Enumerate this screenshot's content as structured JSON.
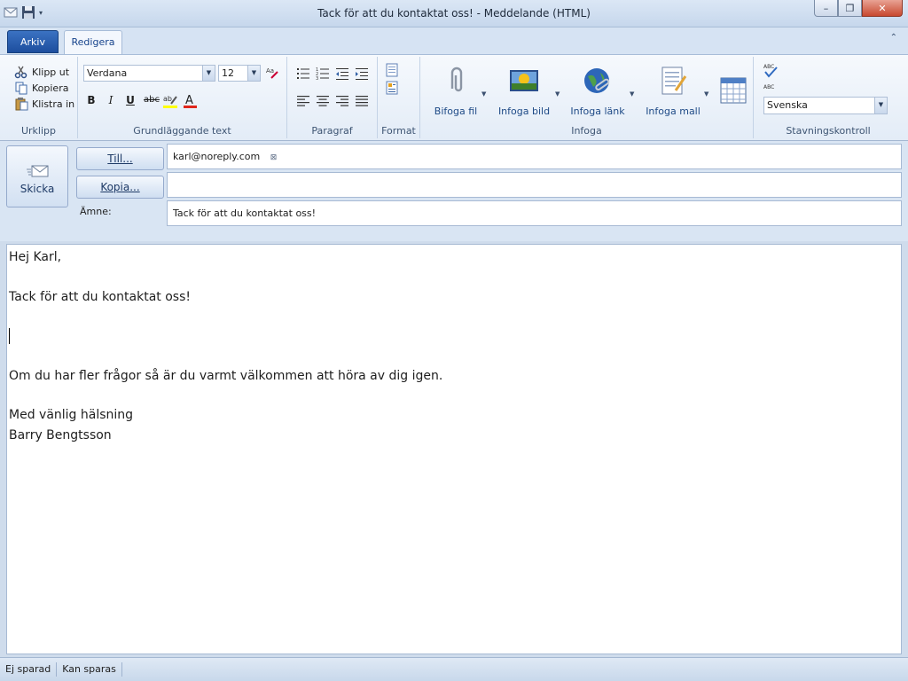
{
  "window": {
    "title": "Tack för att du kontaktat oss! - Meddelande (HTML)",
    "minimize": "–",
    "restore": "❐",
    "close": "✕"
  },
  "tabs": {
    "file": "Arkiv",
    "edit": "Redigera"
  },
  "ribbon": {
    "clipboard": {
      "label": "Urklipp",
      "cut": "Klipp ut",
      "copy": "Kopiera",
      "paste": "Klistra in"
    },
    "basic_text": {
      "label": "Grundläggande text",
      "font": "Verdana",
      "size": "12",
      "bold": "B",
      "italic": "I",
      "underline": "U",
      "strike": "abc"
    },
    "paragraph": {
      "label": "Paragraf"
    },
    "format": {
      "label": "Format"
    },
    "insert": {
      "label": "Infoga",
      "attach_file": "Bifoga fil",
      "insert_picture": "Infoga bild",
      "insert_link": "Infoga länk",
      "insert_template": "Infoga mall"
    },
    "spelling": {
      "label": "Stavningskontroll",
      "language": "Svenska"
    }
  },
  "header": {
    "send": "Skicka",
    "to_button": "Till...",
    "cc_button": "Kopia...",
    "to_value": "karl@noreply.com",
    "cc_value": "",
    "subject_label": "Ämne:",
    "subject_value": "Tack för att du kontaktat oss!"
  },
  "body": {
    "greeting": "Hej Karl,",
    "line1": "Tack för att du kontaktat oss!",
    "line2": "Om du har fler frågor så är du varmt välkommen att höra av dig igen.",
    "closing": "Med vänlig hälsning",
    "signature": "Barry Bengtsson"
  },
  "status": {
    "saved": "Ej sparad",
    "can_save": "Kan sparas"
  }
}
